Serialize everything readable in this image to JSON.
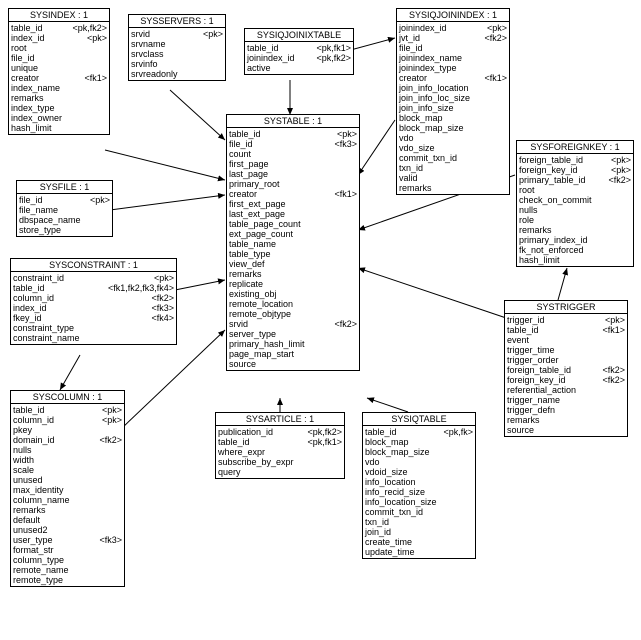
{
  "entities": {
    "sysindex": {
      "title": "SYSINDEX : 1",
      "rows": [
        {
          "c1": "table_id",
          "c2": "<pk,fk2>"
        },
        {
          "c1": "index_id",
          "c2": "<pk>"
        },
        {
          "c1": "root",
          "c2": ""
        },
        {
          "c1": "file_id",
          "c2": ""
        },
        {
          "c1": "unique",
          "c2": ""
        },
        {
          "c1": "creator",
          "c2": "<fk1>"
        },
        {
          "c1": "index_name",
          "c2": ""
        },
        {
          "c1": "remarks",
          "c2": ""
        },
        {
          "c1": "index_type",
          "c2": ""
        },
        {
          "c1": "index_owner",
          "c2": ""
        },
        {
          "c1": "hash_limit",
          "c2": ""
        }
      ]
    },
    "sysservers": {
      "title": "SYSSERVERS : 1",
      "rows": [
        {
          "c1": "srvid",
          "c2": "<pk>"
        },
        {
          "c1": "srvname",
          "c2": ""
        },
        {
          "c1": "srvclass",
          "c2": ""
        },
        {
          "c1": "srvinfo",
          "c2": ""
        },
        {
          "c1": "srvreadonly",
          "c2": ""
        }
      ]
    },
    "sysiqjoinixtable": {
      "title": "SYSIQJOINIXTABLE",
      "rows": [
        {
          "c1": "table_id",
          "c2": "<pk,fk1>"
        },
        {
          "c1": "joinindex_id",
          "c2": "<pk,fk2>"
        },
        {
          "c1": "active",
          "c2": ""
        }
      ]
    },
    "sysiqjoinindex": {
      "title": "SYSIQJOININDEX : 1",
      "rows": [
        {
          "c1": "joinindex_id",
          "c2": "<pk>"
        },
        {
          "c1": "jvt_id",
          "c2": "<fk2>"
        },
        {
          "c1": "file_id",
          "c2": ""
        },
        {
          "c1": "joinindex_name",
          "c2": ""
        },
        {
          "c1": "joinindex_type",
          "c2": ""
        },
        {
          "c1": "creator",
          "c2": "<fk1>"
        },
        {
          "c1": "join_info_location",
          "c2": ""
        },
        {
          "c1": "join_info_loc_size",
          "c2": ""
        },
        {
          "c1": "join_info_size",
          "c2": ""
        },
        {
          "c1": "block_map",
          "c2": ""
        },
        {
          "c1": "block_map_size",
          "c2": ""
        },
        {
          "c1": "vdo",
          "c2": ""
        },
        {
          "c1": "vdo_size",
          "c2": ""
        },
        {
          "c1": "commit_txn_id",
          "c2": ""
        },
        {
          "c1": "txn_id",
          "c2": ""
        },
        {
          "c1": "valid",
          "c2": ""
        },
        {
          "c1": "remarks",
          "c2": ""
        }
      ]
    },
    "sysfile": {
      "title": "SYSFILE : 1",
      "rows": [
        {
          "c1": "file_id",
          "c2": "<pk>"
        },
        {
          "c1": "file_name",
          "c2": ""
        },
        {
          "c1": "dbspace_name",
          "c2": ""
        },
        {
          "c1": "store_type",
          "c2": ""
        }
      ]
    },
    "systable": {
      "title": "SYSTABLE : 1",
      "rows": [
        {
          "c1": "table_id",
          "c2": "<pk>"
        },
        {
          "c1": "file_id",
          "c2": "<fk3>"
        },
        {
          "c1": "count",
          "c2": ""
        },
        {
          "c1": "first_page",
          "c2": ""
        },
        {
          "c1": "last_page",
          "c2": ""
        },
        {
          "c1": "primary_root",
          "c2": ""
        },
        {
          "c1": "creator",
          "c2": "<fk1>"
        },
        {
          "c1": "first_ext_page",
          "c2": ""
        },
        {
          "c1": "last_ext_page",
          "c2": ""
        },
        {
          "c1": "table_page_count",
          "c2": ""
        },
        {
          "c1": "ext_page_count",
          "c2": ""
        },
        {
          "c1": "table_name",
          "c2": ""
        },
        {
          "c1": "table_type",
          "c2": ""
        },
        {
          "c1": "view_def",
          "c2": ""
        },
        {
          "c1": "remarks",
          "c2": ""
        },
        {
          "c1": "replicate",
          "c2": ""
        },
        {
          "c1": "existing_obj",
          "c2": ""
        },
        {
          "c1": "remote_location",
          "c2": ""
        },
        {
          "c1": "remote_objtype",
          "c2": ""
        },
        {
          "c1": "srvid",
          "c2": "<fk2>"
        },
        {
          "c1": "server_type",
          "c2": ""
        },
        {
          "c1": "primary_hash_limit",
          "c2": ""
        },
        {
          "c1": "page_map_start",
          "c2": ""
        },
        {
          "c1": "source",
          "c2": ""
        }
      ]
    },
    "sysforeignkey": {
      "title": "SYSFOREIGNKEY : 1",
      "rows": [
        {
          "c1": "foreign_table_id",
          "c2": "<pk>"
        },
        {
          "c1": "foreign_key_id",
          "c2": "<pk>"
        },
        {
          "c1": "primary_table_id",
          "c2": "<fk2>"
        },
        {
          "c1": "root",
          "c2": ""
        },
        {
          "c1": "check_on_commit",
          "c2": ""
        },
        {
          "c1": "nulls",
          "c2": ""
        },
        {
          "c1": "role",
          "c2": ""
        },
        {
          "c1": "remarks",
          "c2": ""
        },
        {
          "c1": "primary_index_id",
          "c2": ""
        },
        {
          "c1": "fk_not_enforced",
          "c2": ""
        },
        {
          "c1": "hash_limit",
          "c2": ""
        }
      ]
    },
    "sysconstraint": {
      "title": "SYSCONSTRAINT : 1",
      "rows": [
        {
          "c1": "constraint_id",
          "c2": "<pk>"
        },
        {
          "c1": "table_id",
          "c2": "<fk1,fk2,fk3,fk4>"
        },
        {
          "c1": "column_id",
          "c2": "<fk2>"
        },
        {
          "c1": "index_id",
          "c2": "<fk3>"
        },
        {
          "c1": "fkey_id",
          "c2": "<fk4>"
        },
        {
          "c1": "constraint_type",
          "c2": ""
        },
        {
          "c1": "constraint_name",
          "c2": ""
        }
      ]
    },
    "syscolumn": {
      "title": "SYSCOLUMN : 1",
      "rows": [
        {
          "c1": "table_id",
          "c2": "<pk>"
        },
        {
          "c1": "column_id",
          "c2": "<pk>"
        },
        {
          "c1": "pkey",
          "c2": ""
        },
        {
          "c1": "domain_id",
          "c2": "<fk2>"
        },
        {
          "c1": "nulls",
          "c2": ""
        },
        {
          "c1": "width",
          "c2": ""
        },
        {
          "c1": "scale",
          "c2": ""
        },
        {
          "c1": "unused",
          "c2": ""
        },
        {
          "c1": "max_identity",
          "c2": ""
        },
        {
          "c1": "column_name",
          "c2": ""
        },
        {
          "c1": "remarks",
          "c2": ""
        },
        {
          "c1": "default",
          "c2": ""
        },
        {
          "c1": "unused2",
          "c2": ""
        },
        {
          "c1": "user_type",
          "c2": "<fk3>"
        },
        {
          "c1": "format_str",
          "c2": ""
        },
        {
          "c1": "column_type",
          "c2": ""
        },
        {
          "c1": "remote_name",
          "c2": ""
        },
        {
          "c1": "remote_type",
          "c2": ""
        }
      ]
    },
    "sysarticle": {
      "title": "SYSARTICLE : 1",
      "rows": [
        {
          "c1": "publication_id",
          "c2": "<pk,fk2>"
        },
        {
          "c1": "table_id",
          "c2": "<pk,fk1>"
        },
        {
          "c1": "where_expr",
          "c2": ""
        },
        {
          "c1": "subscribe_by_expr",
          "c2": ""
        },
        {
          "c1": "query",
          "c2": ""
        }
      ]
    },
    "sysiqtable": {
      "title": "SYSIQTABLE",
      "rows": [
        {
          "c1": "table_id",
          "c2": "<pk,fk>"
        },
        {
          "c1": "block_map",
          "c2": ""
        },
        {
          "c1": "block_map_size",
          "c2": ""
        },
        {
          "c1": "vdo",
          "c2": ""
        },
        {
          "c1": "vdoid_size",
          "c2": ""
        },
        {
          "c1": "info_location",
          "c2": ""
        },
        {
          "c1": "info_recid_size",
          "c2": ""
        },
        {
          "c1": "info_location_size",
          "c2": ""
        },
        {
          "c1": "commit_txn_id",
          "c2": ""
        },
        {
          "c1": "txn_id",
          "c2": ""
        },
        {
          "c1": "join_id",
          "c2": ""
        },
        {
          "c1": "create_time",
          "c2": ""
        },
        {
          "c1": "update_time",
          "c2": ""
        }
      ]
    },
    "systrigger": {
      "title": "SYSTRIGGER",
      "rows": [
        {
          "c1": "trigger_id",
          "c2": "<pk>"
        },
        {
          "c1": "table_id",
          "c2": "<fk1>"
        },
        {
          "c1": "event",
          "c2": ""
        },
        {
          "c1": "trigger_time",
          "c2": ""
        },
        {
          "c1": "trigger_order",
          "c2": ""
        },
        {
          "c1": "foreign_table_id",
          "c2": "<fk2>"
        },
        {
          "c1": "foreign_key_id",
          "c2": "<fk2>"
        },
        {
          "c1": "referential_action",
          "c2": ""
        },
        {
          "c1": "trigger_name",
          "c2": ""
        },
        {
          "c1": "trigger_defn",
          "c2": ""
        },
        {
          "c1": "remarks",
          "c2": ""
        },
        {
          "c1": "source",
          "c2": ""
        }
      ]
    }
  },
  "chart_data": {
    "type": "erd",
    "entities": [
      "SYSINDEX",
      "SYSSERVERS",
      "SYSIQJOINIXTABLE",
      "SYSIQJOININDEX",
      "SYSFILE",
      "SYSTABLE",
      "SYSFOREIGNKEY",
      "SYSCONSTRAINT",
      "SYSCOLUMN",
      "SYSARTICLE",
      "SYSIQTABLE",
      "SYSTRIGGER"
    ],
    "relationships": [
      {
        "from": "SYSINDEX",
        "to": "SYSTABLE"
      },
      {
        "from": "SYSSERVERS",
        "to": "SYSTABLE"
      },
      {
        "from": "SYSIQJOINIXTABLE",
        "to": "SYSTABLE"
      },
      {
        "from": "SYSIQJOINIXTABLE",
        "to": "SYSIQJOININDEX"
      },
      {
        "from": "SYSIQJOININDEX",
        "to": "SYSTABLE"
      },
      {
        "from": "SYSFILE",
        "to": "SYSTABLE"
      },
      {
        "from": "SYSFOREIGNKEY",
        "to": "SYSTABLE"
      },
      {
        "from": "SYSCONSTRAINT",
        "to": "SYSTABLE"
      },
      {
        "from": "SYSCONSTRAINT",
        "to": "SYSCOLUMN"
      },
      {
        "from": "SYSCOLUMN",
        "to": "SYSTABLE"
      },
      {
        "from": "SYSARTICLE",
        "to": "SYSTABLE"
      },
      {
        "from": "SYSIQTABLE",
        "to": "SYSTABLE"
      },
      {
        "from": "SYSTRIGGER",
        "to": "SYSTABLE"
      },
      {
        "from": "SYSTRIGGER",
        "to": "SYSFOREIGNKEY"
      }
    ]
  }
}
